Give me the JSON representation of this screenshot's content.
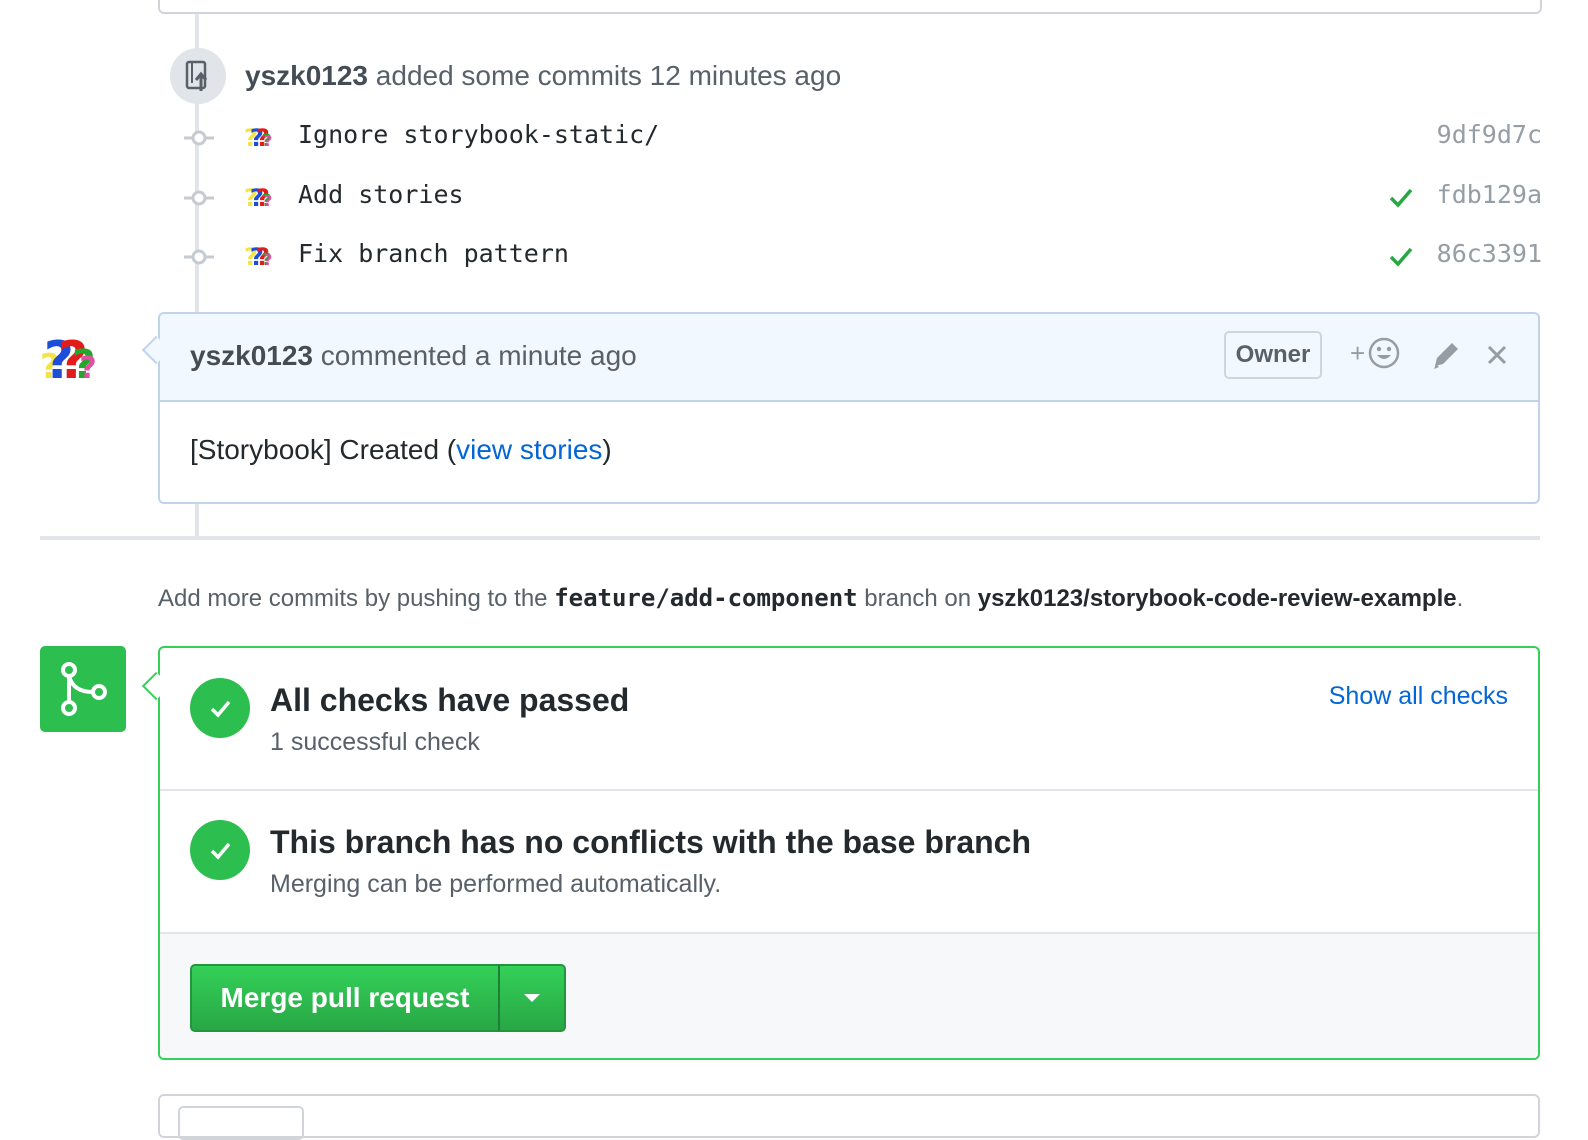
{
  "timeline_event": {
    "author": "yszk0123",
    "action_text": " added some commits 12 minutes ago"
  },
  "commits": [
    {
      "message": "Ignore storybook-static/",
      "sha": "9df9d7c",
      "status": "none"
    },
    {
      "message": "Add stories",
      "sha": "fdb129a",
      "status": "success"
    },
    {
      "message": "Fix branch pattern",
      "sha": "86c3391",
      "status": "success"
    }
  ],
  "comment": {
    "author": "yszk0123",
    "meta": " commented a minute ago",
    "badge": "Owner",
    "reaction_plus": "+",
    "body_prefix": "[Storybook] Created (",
    "body_link": "view stories",
    "body_suffix": ")"
  },
  "push_info": {
    "prefix": "Add more commits by pushing to the ",
    "branch": "feature/add-component",
    "middle": " branch on ",
    "repo": "yszk0123/storybook-code-review-example",
    "suffix": "."
  },
  "merge": {
    "checks_title": "All checks have passed",
    "checks_sub": "1 successful check",
    "show_all": "Show all checks",
    "conflicts_title": "This branch has no conflicts with the base branch",
    "conflicts_sub": "Merging can be performed automatically.",
    "merge_button": "Merge pull request"
  },
  "colors": {
    "success": "#2cbe4e",
    "link": "#0366d6",
    "comment_header_bg": "#f1f8ff"
  },
  "icons": {
    "push": "repo-push-icon",
    "commit": "git-commit-icon",
    "check": "check-icon",
    "smiley": "smiley-icon",
    "edit": "pencil-icon",
    "close": "x-icon",
    "merge": "git-merge-icon",
    "dropdown": "triangle-down-icon"
  }
}
